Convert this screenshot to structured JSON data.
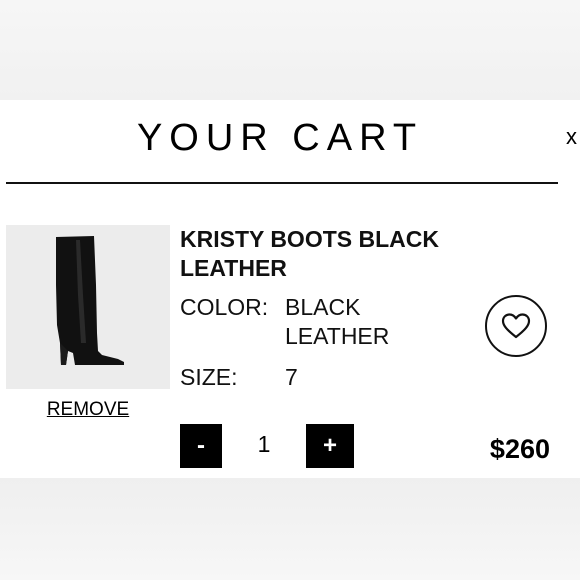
{
  "cart": {
    "title": "YOUR CART",
    "close_label": "x"
  },
  "item": {
    "name": "KRISTY BOOTS BLACK LEATHER",
    "color_label": "COLOR:",
    "color_value": "BLACK LEATHER",
    "size_label": "SIZE:",
    "size_value": "7",
    "remove_label": "REMOVE",
    "quantity": "1",
    "decrement_label": "-",
    "increment_label": "+",
    "price": "$260",
    "image_icon": "black-knee-high-boot",
    "wishlist_icon": "heart-icon"
  },
  "colors": {
    "panel": "#ffffff",
    "backdrop": "#f5f5f5",
    "button": "#000000",
    "text": "#111111"
  }
}
